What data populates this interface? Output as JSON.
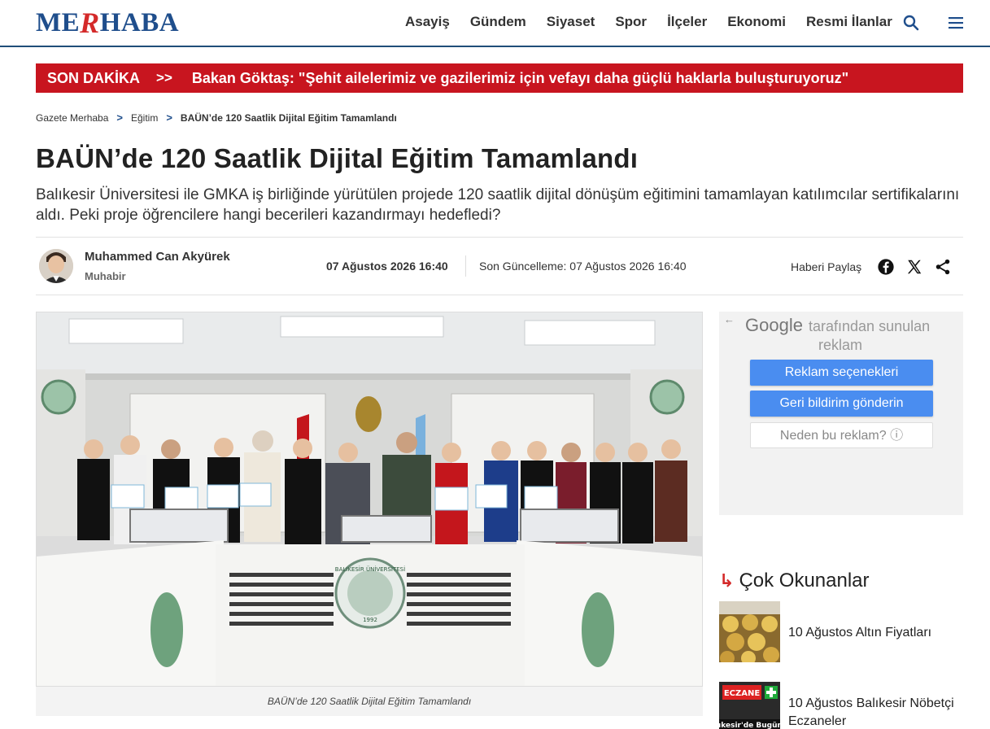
{
  "header": {
    "logo_left": "ME",
    "logo_mid": "R",
    "logo_right": "HABA",
    "nav": [
      "Asayiş",
      "Gündem",
      "Siyaset",
      "Spor",
      "İlçeler",
      "Ekonomi",
      "Resmi İlanlar"
    ],
    "icons": [
      "search-icon",
      "menu-icon"
    ]
  },
  "breaking": {
    "tag": "SON DAKİKA",
    "arrows": ">>",
    "news": "Bakan Göktaş: \"Şehit ailelerimiz ve gazilerimiz için vefayı daha güçlü haklarla buluşturuyoruz\""
  },
  "breadcrumb": {
    "home": "Gazete Merhaba",
    "category": "Eğitim",
    "current": "BAÜN’de 120 Saatlik Dijital Eğitim Tamamlandı",
    "sep": ">"
  },
  "article": {
    "title": "BAÜN’de 120 Saatlik Dijital Eğitim Tamamlandı",
    "summary": "Balıkesir Üniversitesi ile GMKA iş birliğinde yürütülen projede 120 saatlik dijital dönüşüm eğitimini tamamlayan katılımcılar sertifikalarını aldı. Peki proje öğrencilere hangi becerileri kazandırmayı hedefledi?",
    "author": "Muhammed Can Akyürek",
    "role": "Muhabir",
    "date": "07 Ağustos 2026 16:40",
    "updated": "Son Güncelleme: 07 Ağustos 2026 16:40",
    "share_label": "Haberi Paylaş",
    "caption": "BAÜN’de 120 Saatlik Dijital Eğitim Tamamlandı",
    "photo_seal_text": "BALIKESİR ÜNİVERSİTESİ",
    "photo_seal_year": "1992"
  },
  "ad": {
    "back": "←",
    "google": "Google",
    "by_line1": "tarafından sunulan",
    "by_line2": "reklam",
    "btn1": "Reklam seçenekleri",
    "btn2": "Geri bildirim gönderin",
    "btn3": "Neden bu reklam? ⓘ"
  },
  "most_read": {
    "icon": "↳",
    "title": "Çok Okunanlar",
    "items": [
      {
        "text": "10 Ağustos Altın Fiyatları"
      },
      {
        "text": "10 Ağustos Balıkesir Nöbetçi Eczaneler"
      }
    ],
    "thumb2_sign": "ECZANE",
    "thumb2_caption": "lıkesir'de Bugün"
  },
  "colors": {
    "brand": "#1f4e8c",
    "accent": "#c8151f",
    "ad_blue": "#4a8df0"
  }
}
